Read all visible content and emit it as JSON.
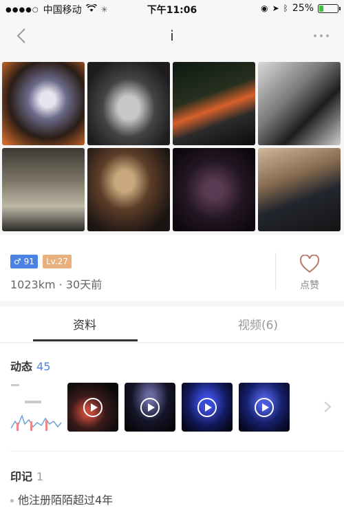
{
  "status_bar": {
    "carrier": "中国移动",
    "time": "下午11:06",
    "battery": "25%",
    "battery_level": 0.25
  },
  "nav": {
    "title": "i"
  },
  "photos": [
    {
      "name": "photo-1"
    },
    {
      "name": "photo-2"
    },
    {
      "name": "photo-3"
    },
    {
      "name": "photo-4"
    },
    {
      "name": "photo-5"
    },
    {
      "name": "photo-6"
    },
    {
      "name": "photo-7"
    },
    {
      "name": "photo-8"
    }
  ],
  "profile": {
    "gender_age": "♂ 91",
    "level": "Lv.27",
    "distance_time": "1023km · 30天前",
    "like_label": "点赞"
  },
  "tabs": {
    "info": "资料",
    "video": "视频(6)"
  },
  "dynamics": {
    "title": "动态",
    "count": "45"
  },
  "marks": {
    "title": "印记",
    "count": "1",
    "item": "他注册陌陌超过4年"
  },
  "colors": {
    "accent_blue": "#4a82e4",
    "level_badge": "#e8b07f",
    "battery_green": "#3cc13b"
  }
}
